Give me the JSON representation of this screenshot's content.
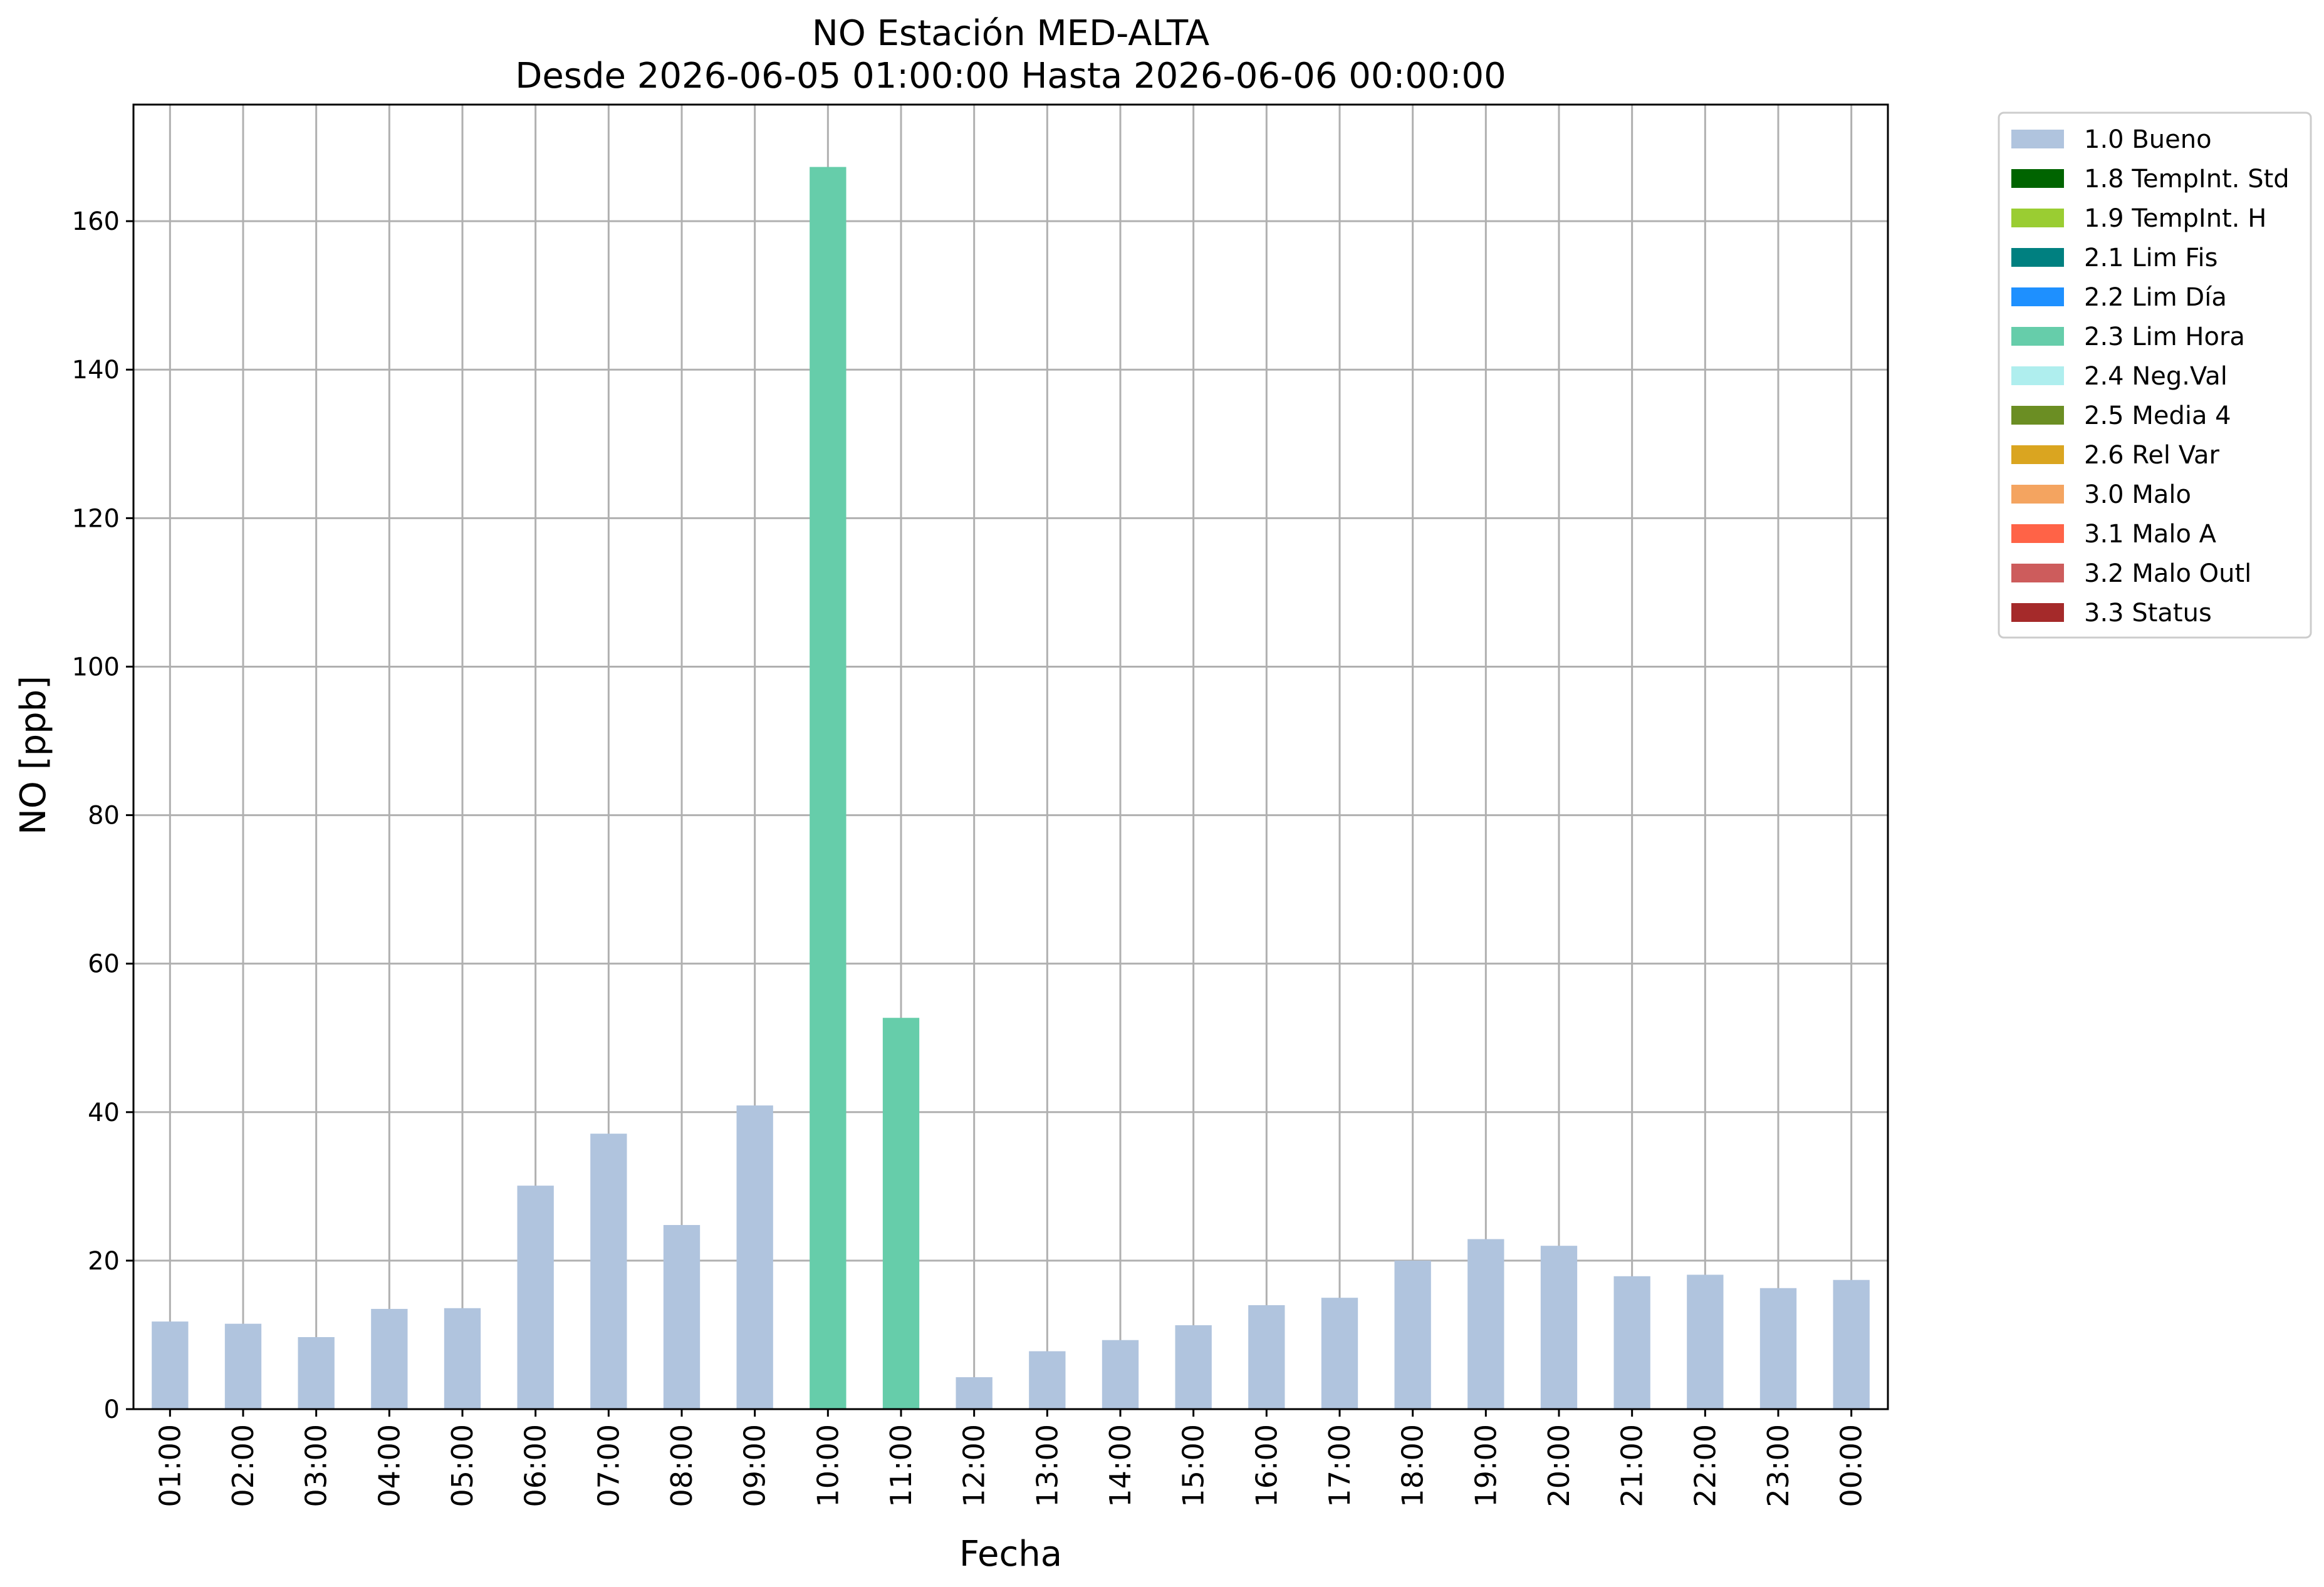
{
  "chart_data": {
    "type": "bar",
    "title": "NO Estación MED-ALTA",
    "subtitle": "Desde 2026-06-05 01:00:00 Hasta 2026-06-06 00:00:00",
    "xlabel": "Fecha",
    "ylabel": "NO [ppb]",
    "ylim": [
      0,
      175.7
    ],
    "yticks": [
      0,
      20,
      40,
      60,
      80,
      100,
      120,
      140,
      160
    ],
    "grid": true,
    "legend_position": "outside-right",
    "categories": [
      "01:00",
      "02:00",
      "03:00",
      "04:00",
      "05:00",
      "06:00",
      "07:00",
      "08:00",
      "09:00",
      "10:00",
      "11:00",
      "12:00",
      "13:00",
      "14:00",
      "15:00",
      "16:00",
      "17:00",
      "18:00",
      "19:00",
      "20:00",
      "21:00",
      "22:00",
      "23:00",
      "00:00"
    ],
    "values": [
      11.8,
      11.5,
      9.7,
      13.5,
      13.6,
      30.1,
      37.1,
      24.8,
      40.9,
      167.3,
      52.7,
      4.3,
      7.8,
      9.3,
      11.3,
      14.0,
      15.0,
      20.0,
      22.9,
      22.0,
      17.9,
      18.1,
      16.3,
      17.4
    ],
    "flags": [
      "1.0 Bueno",
      "1.0 Bueno",
      "1.0 Bueno",
      "1.0 Bueno",
      "1.0 Bueno",
      "1.0 Bueno",
      "1.0 Bueno",
      "1.0 Bueno",
      "1.0 Bueno",
      "2.3 Lim Hora",
      "2.3 Lim Hora",
      "1.0 Bueno",
      "1.0 Bueno",
      "1.0 Bueno",
      "1.0 Bueno",
      "1.0 Bueno",
      "1.0 Bueno",
      "1.0 Bueno",
      "1.0 Bueno",
      "1.0 Bueno",
      "1.0 Bueno",
      "1.0 Bueno",
      "1.0 Bueno",
      "1.0 Bueno"
    ],
    "legend": [
      {
        "label": "1.0 Bueno",
        "color": "#b0c4de"
      },
      {
        "label": "1.8 TempInt. Std",
        "color": "#006400"
      },
      {
        "label": "1.9 TempInt. H",
        "color": "#9acd32"
      },
      {
        "label": "2.1 Lim Fis",
        "color": "#008080"
      },
      {
        "label": "2.2 Lim Día",
        "color": "#1e90ff"
      },
      {
        "label": "2.3 Lim Hora",
        "color": "#66cdaa"
      },
      {
        "label": "2.4 Neg.Val",
        "color": "#afeeee"
      },
      {
        "label": "2.5 Media 4",
        "color": "#6b8e23"
      },
      {
        "label": "2.6 Rel Var",
        "color": "#daa520"
      },
      {
        "label": "3.0 Malo",
        "color": "#f4a460"
      },
      {
        "label": "3.1 Malo A",
        "color": "#ff6347"
      },
      {
        "label": "3.2 Malo Outl",
        "color": "#cd5c5c"
      },
      {
        "label": "3.3 Status",
        "color": "#a52a2a"
      }
    ]
  }
}
